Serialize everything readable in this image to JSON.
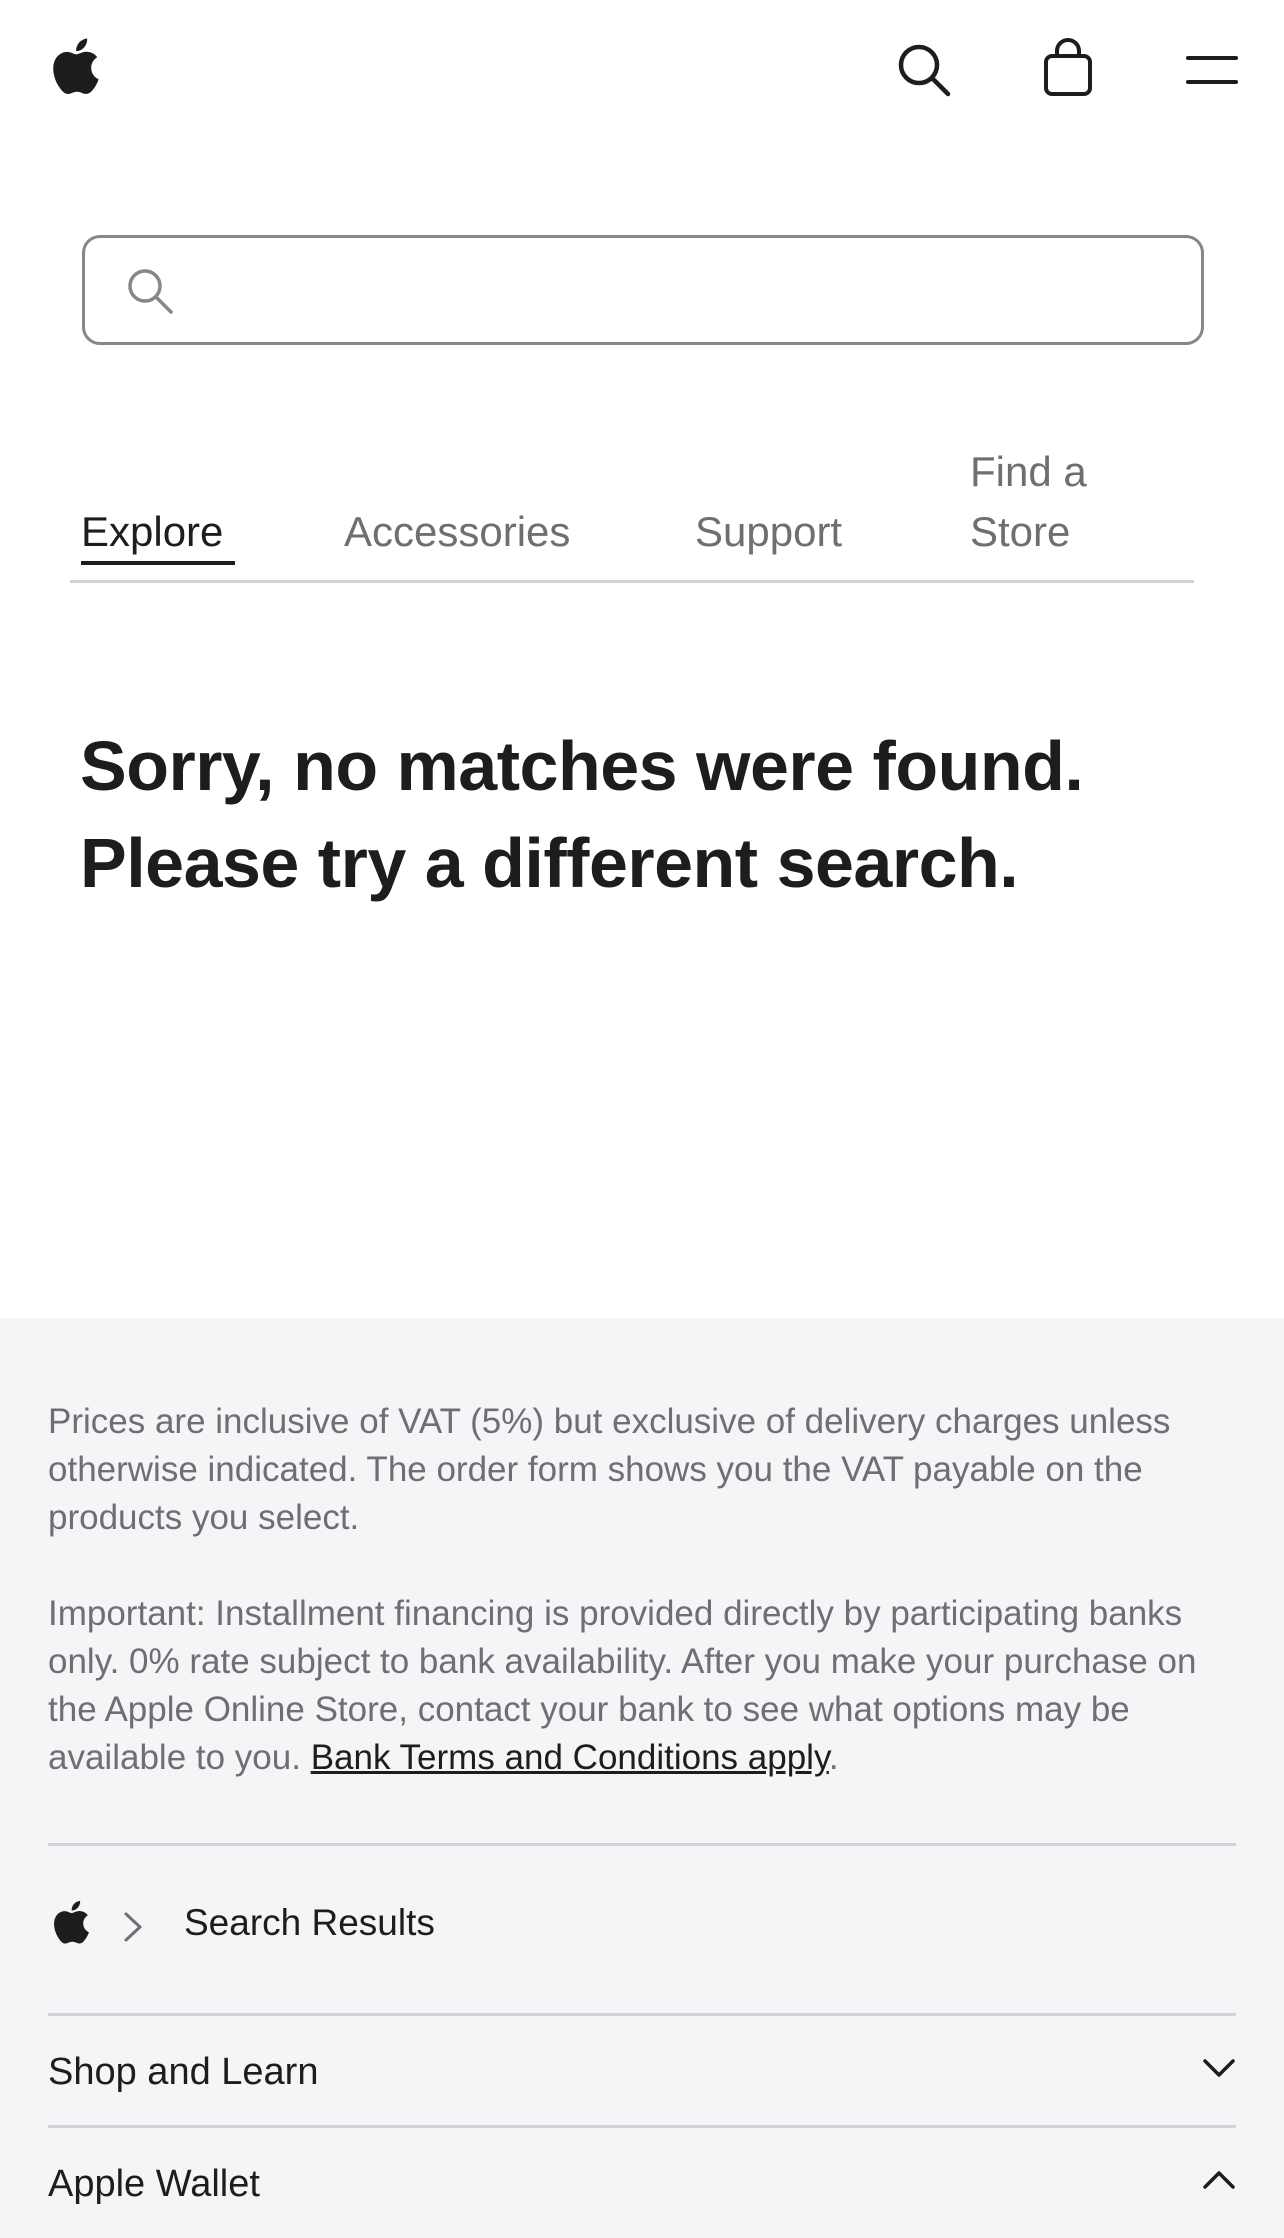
{
  "globalnav": {
    "logo": "apple-logo-icon",
    "search_icon": "search-icon",
    "bag_icon": "shopping-bag-icon",
    "menu_icon": "menu-icon"
  },
  "search": {
    "value": "",
    "placeholder": ""
  },
  "tabs": [
    {
      "label": "Explore",
      "active": true
    },
    {
      "label": "Accessories",
      "active": false
    },
    {
      "label": "Support",
      "active": false
    },
    {
      "label": "Find a Store",
      "active": false
    }
  ],
  "results": {
    "message": "Sorry, no matches were found. Please try a different search."
  },
  "footer": {
    "note_vat": "Prices are inclusive of VAT (5%) but exclusive of delivery charges unless otherwise indicated. The order form shows you the VAT payable on the products you select.",
    "note_financing": "Important: Installment financing is provided directly by participating banks only. 0% rate subject to bank availability. After you make your purchase on the Apple Online Store, contact your bank to see what options may be available to you.",
    "note_financing_link": "Bank Terms and Conditions apply",
    "note_financing_end": ".",
    "breadcrumb": {
      "home_icon": "apple-logo-icon",
      "separator_icon": "chevron-right-icon",
      "current": "Search Results"
    },
    "sections": [
      {
        "label": "Shop and Learn",
        "icon": "chevron-down-icon",
        "expanded": false
      },
      {
        "label": "Apple Wallet",
        "icon": "chevron-up-icon",
        "expanded": true
      }
    ]
  },
  "colors": {
    "text_primary": "#1d1d1f",
    "text_secondary": "#6e6e73",
    "footer_bg": "#f5f5f7",
    "border": "#d2d2d7",
    "search_border": "#86868b"
  }
}
